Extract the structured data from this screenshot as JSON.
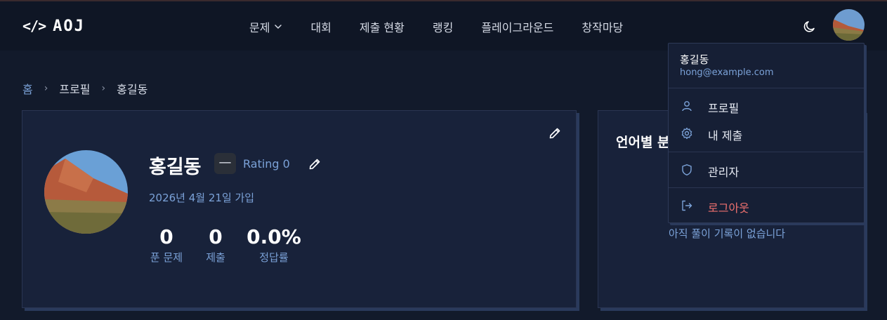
{
  "brand": {
    "code_glyph": "</>",
    "name": "AOJ"
  },
  "nav": {
    "items": [
      {
        "label": "문제",
        "has_dropdown": true
      },
      {
        "label": "대회"
      },
      {
        "label": "제출 현황"
      },
      {
        "label": "랭킹"
      },
      {
        "label": "플레이그라운드"
      },
      {
        "label": "창작마당"
      }
    ]
  },
  "breadcrumb": {
    "home": "홈",
    "section": "프로필",
    "current": "홍길동"
  },
  "profile": {
    "name": "홍길동",
    "tier_badge": "—",
    "rating": "Rating 0",
    "joined": "2026년 4월 21일 가입",
    "stats": [
      {
        "value": "0",
        "label": "푼 문제"
      },
      {
        "value": "0",
        "label": "제출"
      },
      {
        "value": "0.0%",
        "label": "정답률"
      }
    ]
  },
  "lang_card": {
    "title": "언어별 분",
    "empty": "아직 풀이 기록이 없습니다"
  },
  "dropdown": {
    "user_name": "홍길동",
    "email": "hong@example.com",
    "items": [
      {
        "label": "프로필",
        "icon": "user-icon"
      },
      {
        "label": "내 제출",
        "icon": "gear-icon"
      },
      {
        "label": "관리자",
        "icon": "shield-icon"
      },
      {
        "label": "로그아웃",
        "icon": "logout-icon"
      }
    ]
  },
  "colors": {
    "background": "#121a2b",
    "navbar": "#0f1625",
    "card": "#18223a",
    "accent": "#7ba2d8",
    "danger": "#f0716f"
  }
}
